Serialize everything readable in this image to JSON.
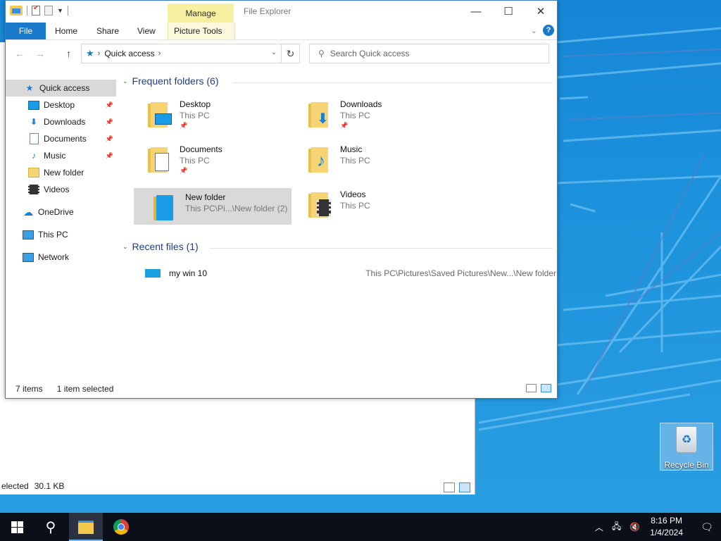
{
  "window": {
    "app_title": "File Explorer",
    "manage_tab": "Manage",
    "ribbon_tabs": [
      "File",
      "Home",
      "Share",
      "View",
      "Picture Tools"
    ],
    "controls": {
      "minimize": "—",
      "maximize": "☐",
      "close": "✕"
    },
    "help": "?"
  },
  "nav": {
    "back": "←",
    "forward": "→",
    "up": "↑",
    "breadcrumb": "Quick access",
    "refresh": "↻",
    "search_placeholder": "Search Quick access"
  },
  "sidebar": {
    "items": [
      {
        "label": "Quick access",
        "icon": "star-icon",
        "selected": true
      },
      {
        "label": "Desktop",
        "icon": "desktop-icon",
        "pinned": true
      },
      {
        "label": "Downloads",
        "icon": "download-icon",
        "pinned": true
      },
      {
        "label": "Documents",
        "icon": "documents-icon",
        "pinned": true
      },
      {
        "label": "Music",
        "icon": "music-icon",
        "pinned": true
      },
      {
        "label": "New folder",
        "icon": "folder-icon"
      },
      {
        "label": "Videos",
        "icon": "videos-icon"
      },
      {
        "label": "OneDrive",
        "icon": "cloud-icon"
      },
      {
        "label": "This PC",
        "icon": "computer-icon"
      },
      {
        "label": "Network",
        "icon": "network-icon"
      }
    ]
  },
  "frequent": {
    "header": "Frequent folders (6)",
    "folders": [
      {
        "name": "Desktop",
        "location": "This PC",
        "pinned": true
      },
      {
        "name": "Downloads",
        "location": "This PC",
        "pinned": true
      },
      {
        "name": "Documents",
        "location": "This PC",
        "pinned": true
      },
      {
        "name": "Music",
        "location": "This PC",
        "pinned": false
      },
      {
        "name": "New folder",
        "location": "This PC\\Pi...\\New folder (2)",
        "pinned": false,
        "selected": true
      },
      {
        "name": "Videos",
        "location": "This PC",
        "pinned": false
      }
    ]
  },
  "recent": {
    "header": "Recent files (1)",
    "files": [
      {
        "name": "my win 10",
        "path": "This PC\\Pictures\\Saved Pictures\\New...\\New folder"
      }
    ]
  },
  "status": {
    "items": "7 items",
    "selected": "1 item selected"
  },
  "back_window": {
    "status_selected": "elected",
    "status_size": "30.1 KB"
  },
  "desktop": {
    "recycle_bin": "Recycle Bin"
  },
  "taskbar": {
    "clock_time": "8:16 PM",
    "clock_date": "1/4/2024",
    "apps": [
      "start-icon",
      "search-icon",
      "file-explorer-icon",
      "chrome-icon"
    ]
  }
}
